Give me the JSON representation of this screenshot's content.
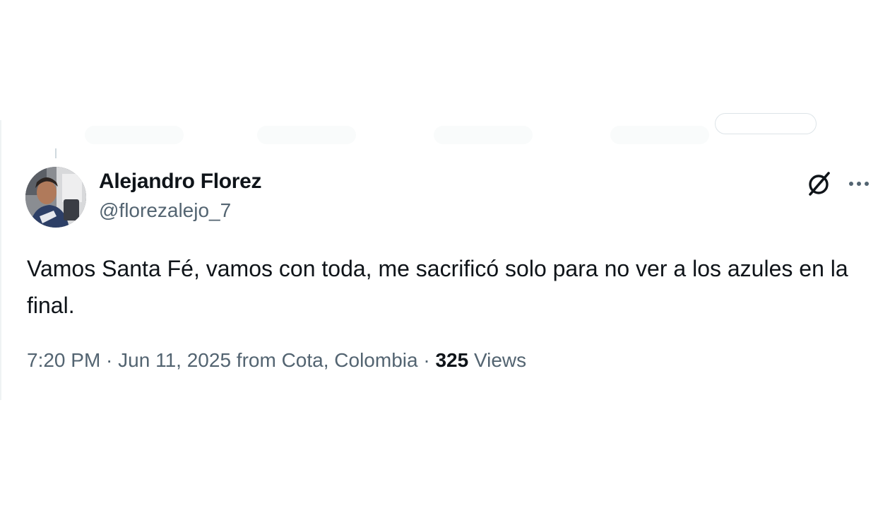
{
  "tweet": {
    "author": {
      "display_name": "Alejandro Florez",
      "handle": "@florezalejo_7"
    },
    "text": "Vamos Santa Fé, vamos con toda, me sacrificó solo para no ver a los azules en la final.",
    "meta": {
      "time": "7:20 PM",
      "separator1": " · ",
      "date": "Jun 11, 2025",
      "location": " from Cota, Colombia",
      "separator2": " · ",
      "views_count": "325",
      "views_label": " Views"
    },
    "icons": {
      "grok": "grok-icon",
      "more": "more-icon"
    }
  },
  "colors": {
    "text_primary": "#0f1419",
    "text_secondary": "#536471",
    "border": "#eff3f4"
  }
}
